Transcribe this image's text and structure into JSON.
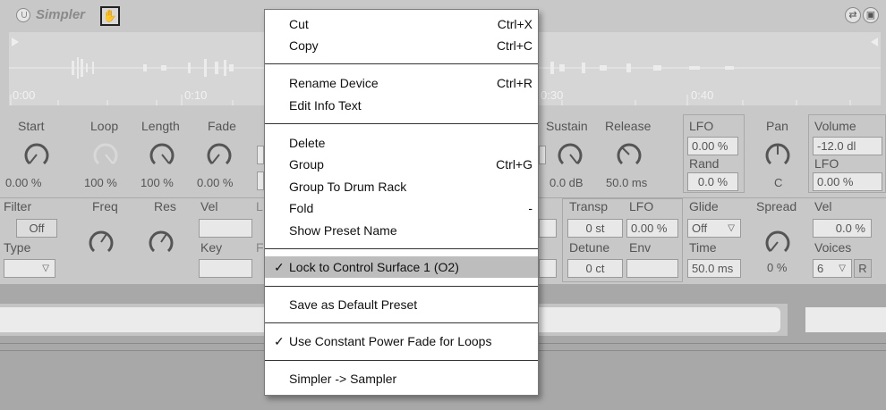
{
  "device": {
    "title": "Simpler",
    "timeline": [
      "0:00",
      "0:10",
      "0:30",
      "0:40"
    ],
    "controls": {
      "start": {
        "label": "Start",
        "value": "0.00 %"
      },
      "loop": {
        "label": "Loop",
        "value": "100 %"
      },
      "length": {
        "label": "Length",
        "value": "100 %"
      },
      "fade": {
        "label": "Fade",
        "value": "0.00 %"
      },
      "sustain": {
        "label": "Sustain",
        "value": "0.0 dB"
      },
      "release": {
        "label": "Release",
        "value": "50.0 ms"
      },
      "lfo": {
        "label": "LFO",
        "value": "0.00 %",
        "rand_label": "Rand",
        "rand_value": "0.0 %"
      },
      "pan": {
        "label": "Pan",
        "value": "C"
      },
      "volume": {
        "label": "Volume",
        "value": "-12.0 dl",
        "lfo_label": "LFO",
        "lfo_value": "0.00 %"
      },
      "filter": {
        "label": "Filter",
        "value": "Off",
        "type_label": "Type"
      },
      "freq": {
        "label": "Freq"
      },
      "res": {
        "label": "Res"
      },
      "vel": {
        "label": "Vel",
        "key_label": "Key"
      },
      "transp": {
        "label": "Transp",
        "value": "0 st"
      },
      "lfo2": {
        "label": "LFO",
        "value": "0.00 %"
      },
      "detune": {
        "label": "Detune",
        "value": "0 ct"
      },
      "env": {
        "label": "Env"
      },
      "glide": {
        "label": "Glide",
        "value": "Off",
        "time_label": "Time",
        "time_value": "50.0 ms"
      },
      "spread": {
        "label": "Spread",
        "value": "0 %"
      },
      "vel2": {
        "label": "Vel",
        "value": "0.0 %"
      },
      "voices": {
        "label": "Voices",
        "value": "6",
        "r": "R"
      }
    }
  },
  "menu": {
    "items": [
      {
        "label": "Cut",
        "shortcut": "Ctrl+X"
      },
      {
        "label": "Copy",
        "shortcut": "Ctrl+C"
      },
      {
        "label": "Rename Device",
        "shortcut": "Ctrl+R"
      },
      {
        "label": "Edit Info Text",
        "shortcut": ""
      },
      {
        "label": "Delete",
        "shortcut": ""
      },
      {
        "label": "Group",
        "shortcut": "Ctrl+G"
      },
      {
        "label": "Group To Drum Rack",
        "shortcut": ""
      },
      {
        "label": "Fold",
        "shortcut": "-"
      },
      {
        "label": "Show Preset Name",
        "shortcut": ""
      },
      {
        "label": "Lock to Control Surface 1 (O2)",
        "checked": true
      },
      {
        "label": "Save as Default Preset"
      },
      {
        "label": "Use Constant Power Fade for Loops",
        "checked": true
      },
      {
        "label": "Simpler -> Sampler"
      }
    ],
    "check_mark": "✓"
  }
}
